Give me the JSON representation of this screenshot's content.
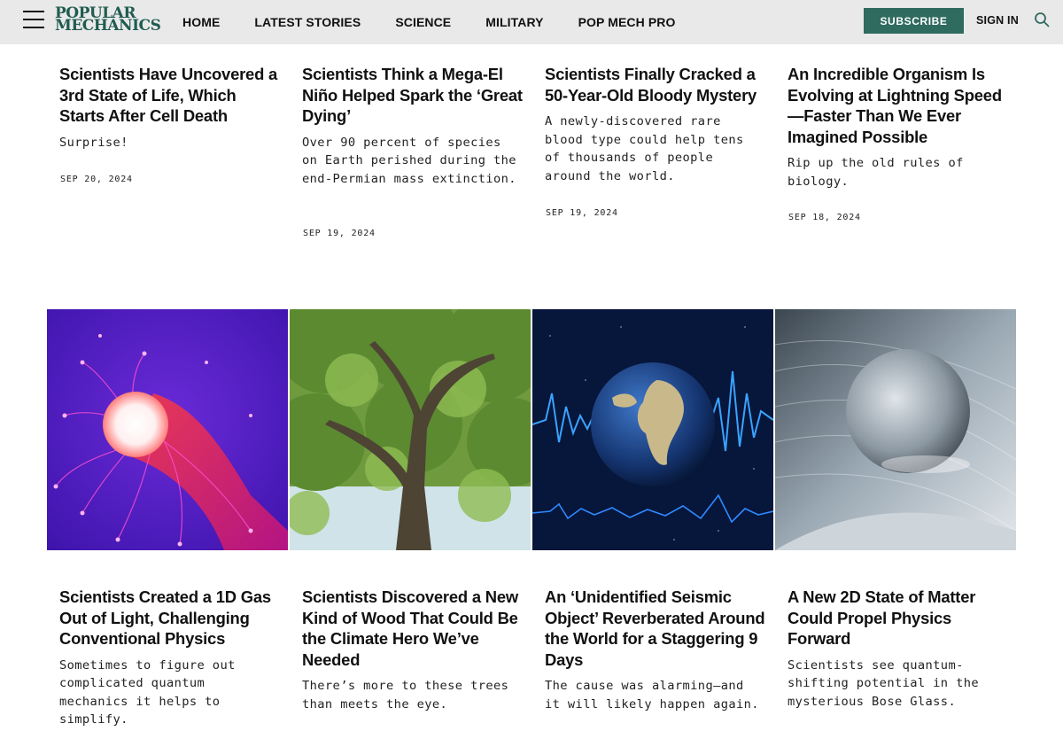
{
  "header": {
    "logo_line1": "POPULAR",
    "logo_line2": "MECHANICS",
    "nav": [
      "HOME",
      "LATEST STORIES",
      "SCIENCE",
      "MILITARY",
      "POP MECH PRO"
    ],
    "subscribe_label": "SUBSCRIBE",
    "signin_label": "SIGN IN"
  },
  "top_articles": [
    {
      "headline": "Scientists Have Uncovered a 3rd State of Life, Which Starts After Cell Death",
      "dek": "Surprise!",
      "date": "SEP 20, 2024"
    },
    {
      "headline": "Scientists Think a Mega-El Niño Helped Spark the ‘Great Dying’",
      "dek": "Over 90 percent of species on Earth perished during the end-Permian mass extinction.",
      "date": "SEP 19, 2024"
    },
    {
      "headline": "Scientists Finally Cracked a 50-Year-Old Bloody Mystery",
      "dek": "A newly-discovered rare blood type could help tens of thousands of people around the world.",
      "date": "SEP 19, 2024"
    },
    {
      "headline": "An Incredible Organism Is Evolving at Lightning Speed—Faster Than We Ever Imagined Possible",
      "dek": "Rip up the old rules of biology.",
      "date": "SEP 18, 2024"
    }
  ],
  "bottom_articles": [
    {
      "headline": "Scientists Created a 1D Gas Out of Light, Challenging Conventional Physics",
      "dek": "Sometimes to figure out complicated quantum mechanics it helps to simplify."
    },
    {
      "headline": "Scientists Discovered a New Kind of Wood That Could Be the Climate Hero We’ve Needed",
      "dek": "There’s more to these trees than meets the eye."
    },
    {
      "headline": "An ‘Unidentified Seismic Object’ Reverberated Around the World for a Staggering 9 Days",
      "dek": "The cause was alarming—and it will likely happen again."
    },
    {
      "headline": "A New 2D State of Matter Could Propel Physics Forward",
      "dek": "Scientists see quantum-shifting potential in the mysterious Bose Glass."
    }
  ],
  "colors": {
    "brand_green": "#205c4f",
    "subscribe_bg": "#2f6b5f",
    "header_bg": "#e9e9e9"
  }
}
